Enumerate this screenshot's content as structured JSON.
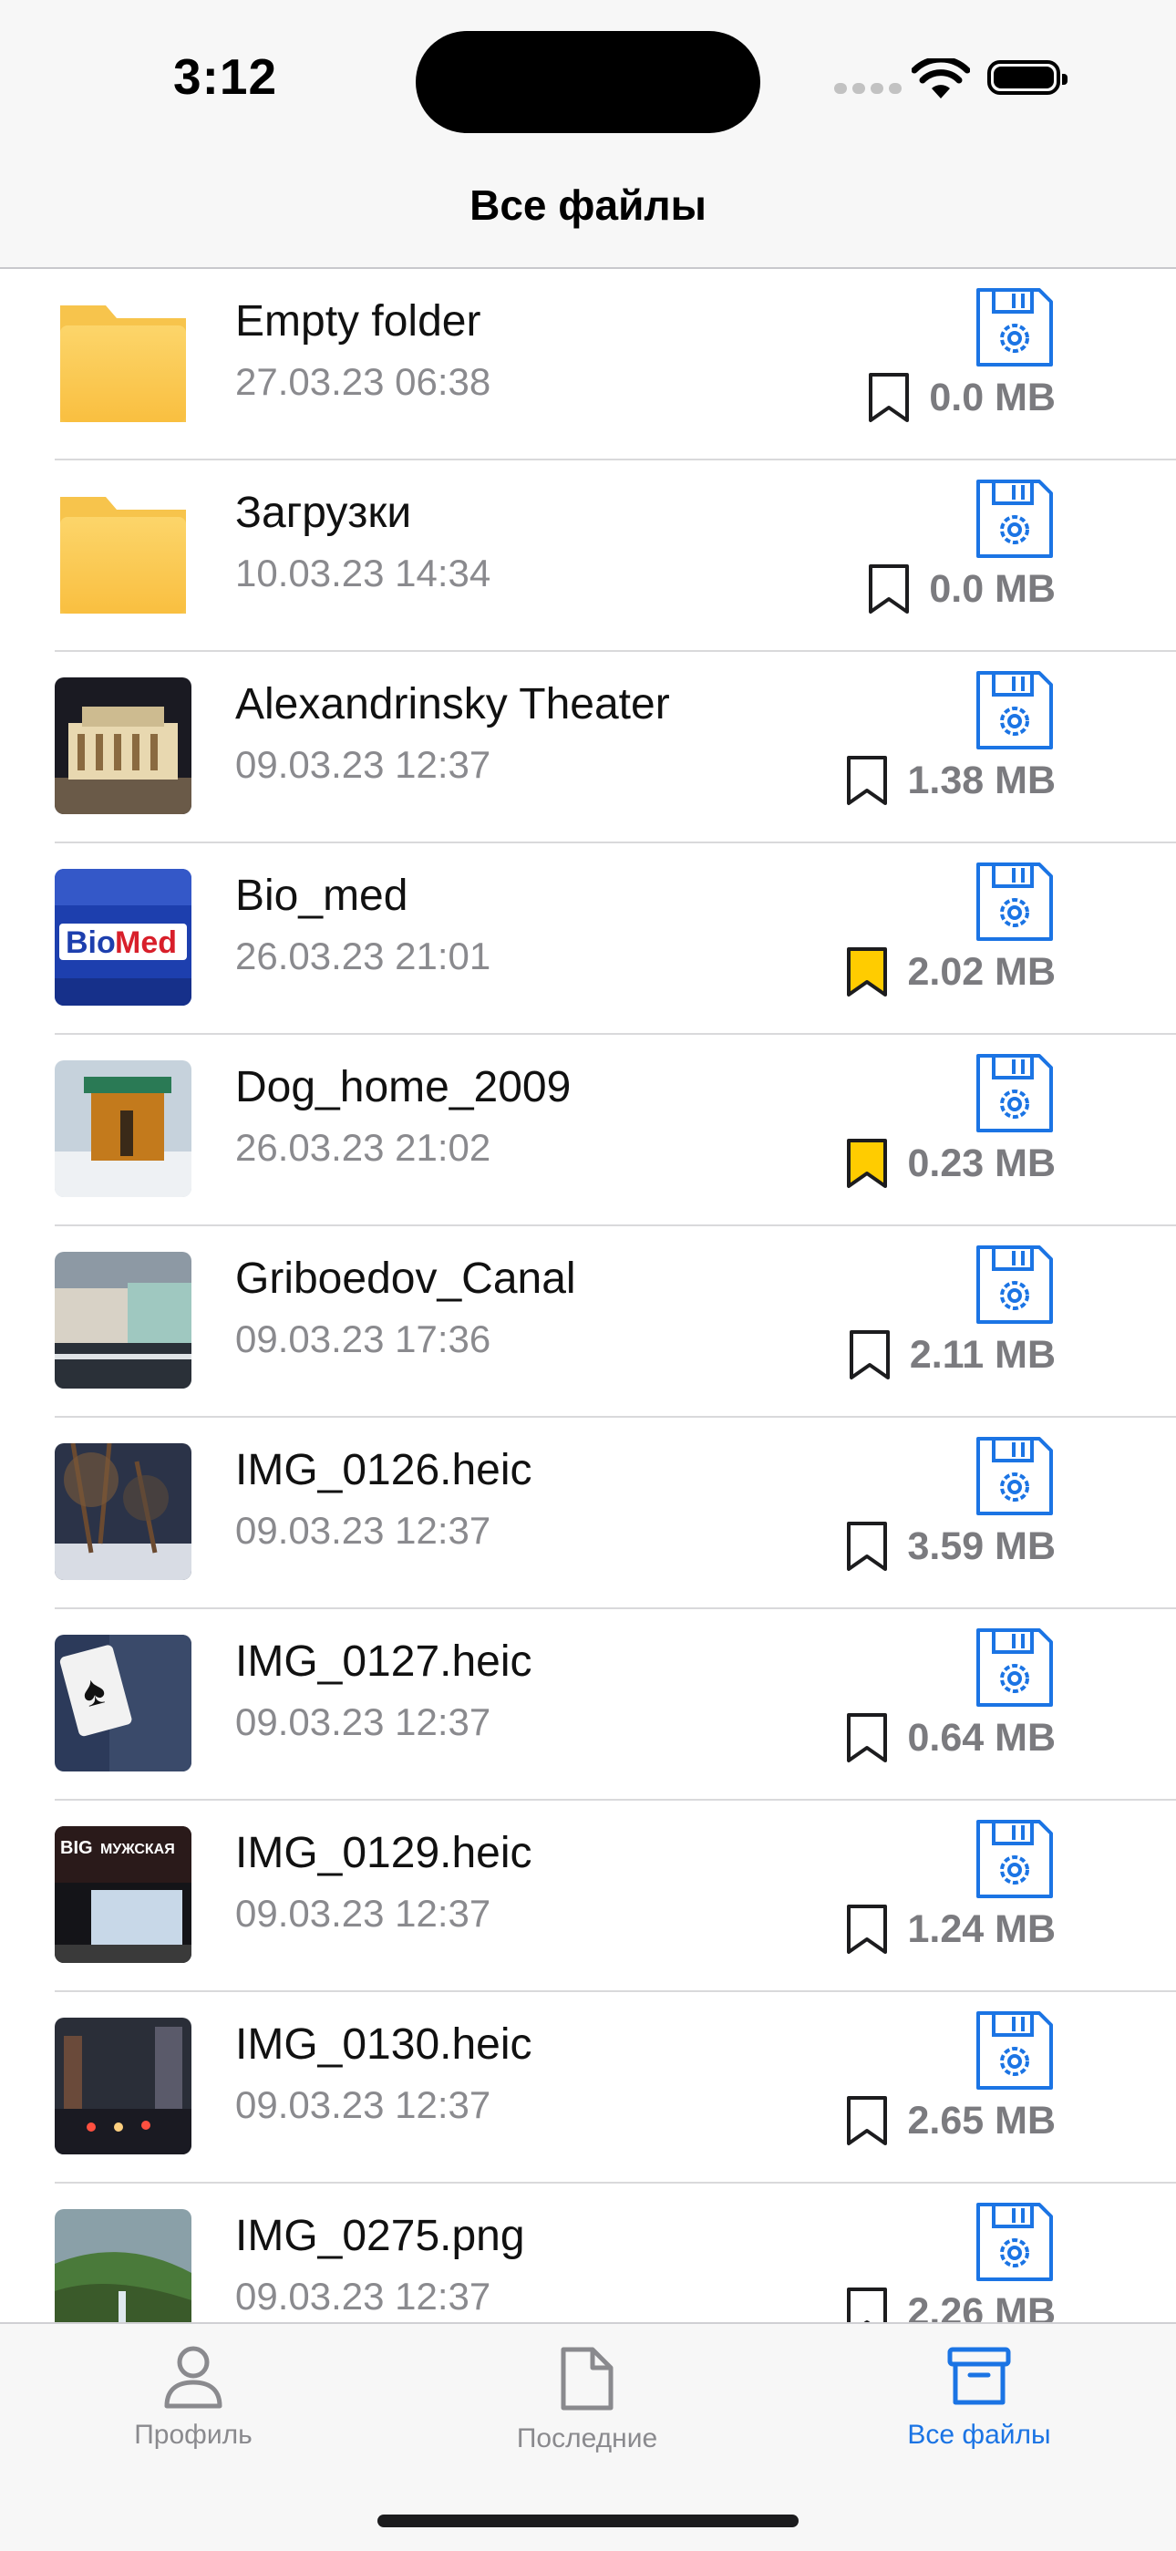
{
  "status": {
    "time": "3:12"
  },
  "nav": {
    "title": "Все файлы"
  },
  "files": [
    {
      "name": "Empty folder",
      "date": "27.03.23 06:38",
      "size": "0.0 MB",
      "kind": "folder",
      "bookmarked": false
    },
    {
      "name": "Загрузки",
      "date": "10.03.23 14:34",
      "size": "0.0 MB",
      "kind": "folder",
      "bookmarked": false
    },
    {
      "name": "Alexandrinsky Theater",
      "date": "09.03.23 12:37",
      "size": "1.38 MB",
      "kind": "image",
      "bookmarked": false
    },
    {
      "name": "Bio_med",
      "date": "26.03.23 21:01",
      "size": "2.02 MB",
      "kind": "image",
      "bookmarked": true
    },
    {
      "name": "Dog_home_2009",
      "date": "26.03.23 21:02",
      "size": "0.23 MB",
      "kind": "image",
      "bookmarked": true
    },
    {
      "name": "Griboedov_Canal",
      "date": "09.03.23 17:36",
      "size": "2.11 MB",
      "kind": "image",
      "bookmarked": false
    },
    {
      "name": "IMG_0126.heic",
      "date": "09.03.23 12:37",
      "size": "3.59 MB",
      "kind": "image",
      "bookmarked": false
    },
    {
      "name": "IMG_0127.heic",
      "date": "09.03.23 12:37",
      "size": "0.64 MB",
      "kind": "image",
      "bookmarked": false
    },
    {
      "name": "IMG_0129.heic",
      "date": "09.03.23 12:37",
      "size": "1.24 MB",
      "kind": "image",
      "bookmarked": false
    },
    {
      "name": "IMG_0130.heic",
      "date": "09.03.23 12:37",
      "size": "2.65 MB",
      "kind": "image",
      "bookmarked": false
    },
    {
      "name": "IMG_0275.png",
      "date": "09.03.23 12:37",
      "size": "2.26 MB",
      "kind": "image",
      "bookmarked": false
    }
  ],
  "tabs": [
    {
      "label": "Профиль",
      "icon": "person-icon",
      "active": false
    },
    {
      "label": "Последние",
      "icon": "document-icon",
      "active": false
    },
    {
      "label": "Все файлы",
      "icon": "archive-box-icon",
      "active": true
    }
  ],
  "colors": {
    "accent": "#1b74e4",
    "bookmark_active": "#ffcc00",
    "folder": "#fbc74f",
    "secondary_text": "#8a8a8e"
  }
}
